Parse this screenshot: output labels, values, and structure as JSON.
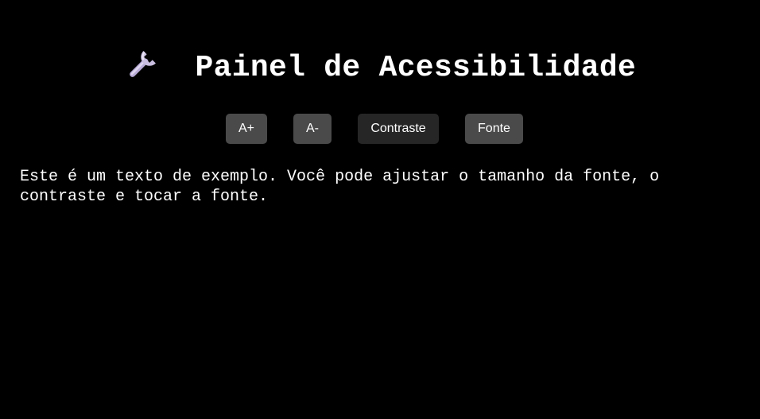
{
  "header": {
    "icon": "wrench-icon",
    "title": "Painel de Acessibilidade"
  },
  "toolbar": {
    "increase_label": "A+",
    "decrease_label": "A-",
    "contrast_label": "Contraste",
    "font_label": "Fonte"
  },
  "content": {
    "sample_text": "Este é um texto de exemplo. Você pode ajustar o tamanho da fonte, o contraste e tocar a fonte."
  },
  "colors": {
    "background": "#000000",
    "text": "#ffffff",
    "button": "#4a4a4a",
    "button_active": "#262626",
    "icon_metal": "#c9bedf"
  }
}
